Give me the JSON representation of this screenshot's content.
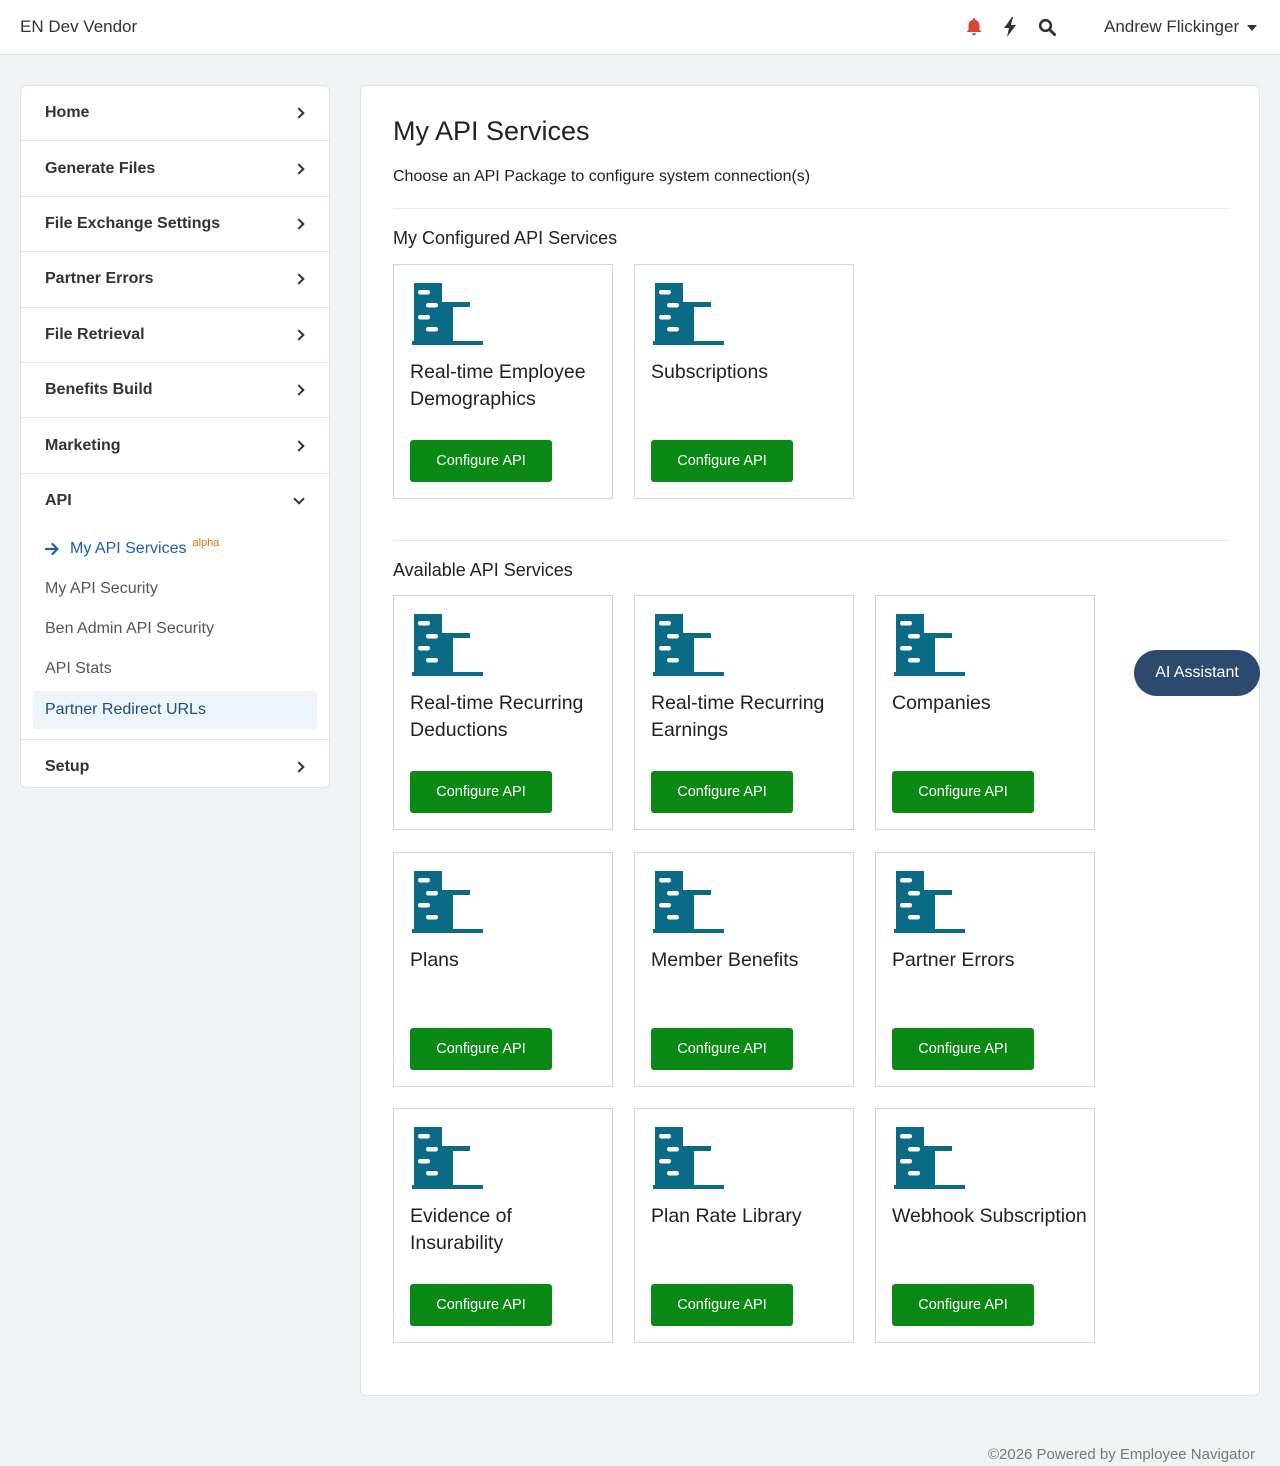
{
  "header": {
    "brand": "EN Dev Vendor",
    "icons": [
      "bell-icon",
      "bolt-icon",
      "search-icon"
    ],
    "bell_color": "#d9463b",
    "user_name": "Andrew Flickinger"
  },
  "sidebar": {
    "items": [
      {
        "label": "Home"
      },
      {
        "label": "Generate Files"
      },
      {
        "label": "File Exchange Settings"
      },
      {
        "label": "Partner Errors"
      },
      {
        "label": "File Retrieval"
      },
      {
        "label": "Benefits Build"
      },
      {
        "label": "Marketing"
      }
    ],
    "api": {
      "label": "API",
      "sub_items": [
        {
          "label": "My API Services",
          "badge": "alpha",
          "active": true
        },
        {
          "label": "My API Security"
        },
        {
          "label": "Ben Admin API Security"
        },
        {
          "label": "API Stats"
        },
        {
          "label": "Partner Redirect URLs",
          "highlighted": true
        }
      ]
    },
    "setup": {
      "label": "Setup"
    }
  },
  "main": {
    "title": "My API Services",
    "subtitle": "Choose an API Package to configure system connection(s)",
    "configured_title": "My Configured API Services",
    "configured": [
      {
        "title": "Real-time Employee Demographics",
        "button": "Configure API"
      },
      {
        "title": "Subscriptions",
        "button": "Configure API"
      }
    ],
    "available_title": "Available API Services",
    "available": [
      {
        "title": "Real-time Recurring Deductions",
        "button": "Configure API"
      },
      {
        "title": "Real-time Recurring Earnings",
        "button": "Configure API"
      },
      {
        "title": "Companies",
        "button": "Configure API"
      },
      {
        "title": "Plans",
        "button": "Configure API"
      },
      {
        "title": "Member Benefits",
        "button": "Configure API"
      },
      {
        "title": "Partner Errors",
        "button": "Configure API"
      },
      {
        "title": "Evidence of Insurability",
        "button": "Configure API"
      },
      {
        "title": "Plan Rate Library",
        "button": "Configure API"
      },
      {
        "title": "Webhook Subscription",
        "button": "Configure API"
      }
    ]
  },
  "ai_assistant": "AI Assistant",
  "footer": "©2026 Powered by Employee Navigator",
  "colors": {
    "accent_blue": "#1a5fb4",
    "button_green": "#0a8a14",
    "icon_teal": "#0b6a85",
    "ai_button": "#2c4a6e"
  }
}
